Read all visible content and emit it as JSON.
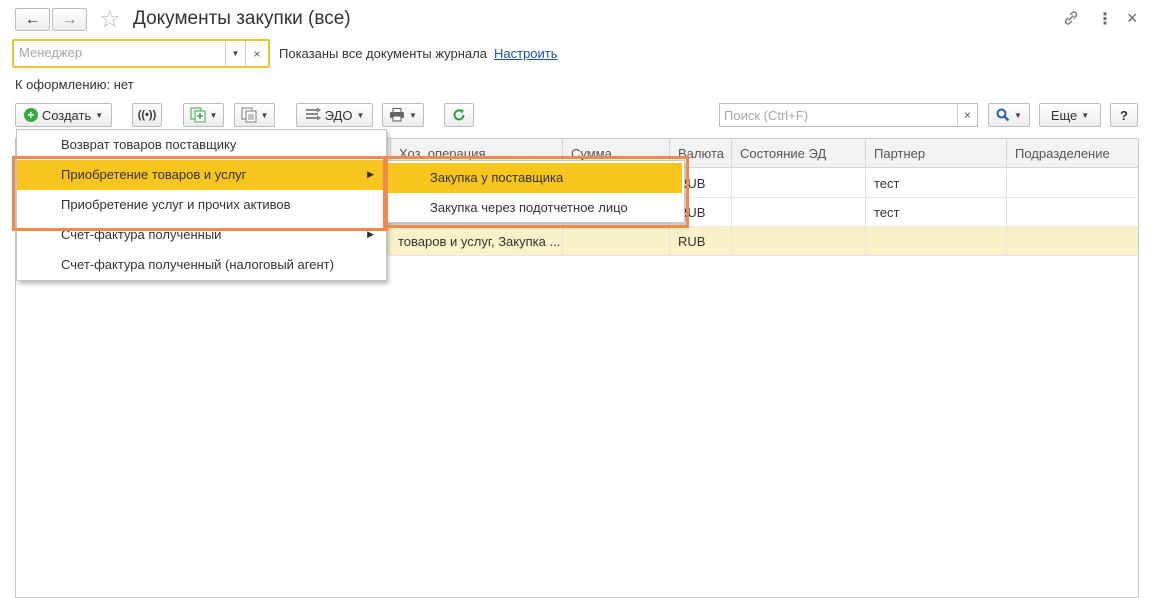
{
  "header": {
    "title": "Документы закупки (все)",
    "back_icon": "←",
    "forward_icon": "→",
    "star_icon": "☆",
    "link_icon": "🔗",
    "more_icon": "⋮",
    "close_icon": "×"
  },
  "filter": {
    "manager_placeholder": "Менеджер",
    "clear_icon": "×",
    "info_text": "Показаны все документы журнала",
    "configure_link": "Настроить",
    "to_process": "К оформлению: нет"
  },
  "toolbar": {
    "create_label": "Создать",
    "edo_label": "ЭДО",
    "search_placeholder": "Поиск (Ctrl+F)",
    "search_clear": "×",
    "more_label": "Еще",
    "help_label": "?"
  },
  "table": {
    "columns": [
      "Хоз. операция",
      "Сумма",
      "Валюта",
      "Состояние ЭД",
      "Партнер",
      "Подразделение"
    ],
    "rows": [
      {
        "operation": "",
        "sum": "",
        "currency": "RUB",
        "state": "",
        "partner": "тест",
        "division": ""
      },
      {
        "operation": "",
        "sum": "",
        "currency": "RUB",
        "state": "",
        "partner": "тест",
        "division": ""
      },
      {
        "operation": "товаров и услуг, Закупка ...",
        "sum": "",
        "currency": "RUB",
        "state": "",
        "partner": "",
        "division": ""
      }
    ]
  },
  "create_menu": {
    "items": [
      {
        "label": "Возврат товаров поставщику"
      },
      {
        "label": "Приобретение товаров и услуг"
      },
      {
        "label": "Приобретение услуг и прочих активов"
      },
      {
        "label": "Счет-фактура полученный"
      },
      {
        "label": "Счет-фактура полученный (налоговый агент)"
      }
    ],
    "submenu": [
      {
        "label": "Закупка у поставщика"
      },
      {
        "label": "Закупка через подотчетное лицо"
      }
    ]
  },
  "colors": {
    "highlight": "#f7c51d",
    "selected_row": "#fbf1c9",
    "callout": "#f08a4a",
    "link": "#1a4fb0",
    "refresh": "#2e9e3e"
  }
}
